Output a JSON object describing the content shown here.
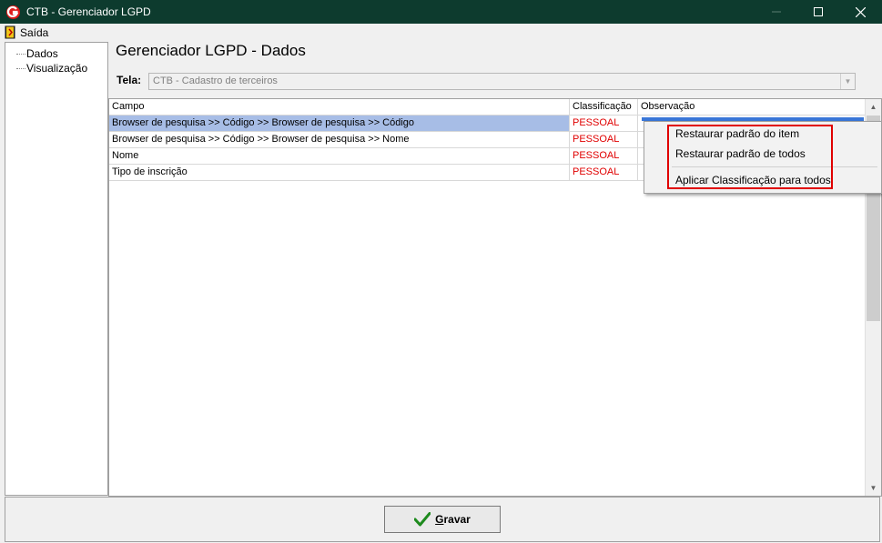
{
  "window": {
    "title": "CTB - Gerenciador LGPD",
    "controls": [
      "minimize",
      "maximize",
      "close"
    ]
  },
  "menu": {
    "exit_label": "Saída"
  },
  "tree": {
    "items": [
      {
        "label": "Dados"
      },
      {
        "label": "Visualização"
      }
    ]
  },
  "page": {
    "title": "Gerenciador LGPD - Dados",
    "screen_label": "Tela:",
    "screen_value": "CTB - Cadastro de terceiros"
  },
  "grid": {
    "columns": [
      "Campo",
      "Classificação",
      "Observação"
    ],
    "rows": [
      {
        "campo": "Browser de pesquisa >> Código >> Browser de pesquisa >> Código",
        "classificacao": "PESSOAL",
        "observacao": ""
      },
      {
        "campo": "Browser de pesquisa >> Código >> Browser de pesquisa >> Nome",
        "classificacao": "PESSOAL",
        "observacao": ""
      },
      {
        "campo": "Nome",
        "classificacao": "PESSOAL",
        "observacao": ""
      },
      {
        "campo": "Tipo de inscrição",
        "classificacao": "PESSOAL",
        "observacao": ""
      }
    ]
  },
  "context_menu": {
    "items": [
      "Restaurar padrão do item",
      "Restaurar padrão de todos",
      "Aplicar Classificação para todos"
    ]
  },
  "footer": {
    "save_label": "Gravar"
  },
  "colors": {
    "titlebar": "#0d3b2e",
    "classification": "#e00000",
    "selection": "#a7bde6",
    "highlight_box": "#e00000"
  }
}
